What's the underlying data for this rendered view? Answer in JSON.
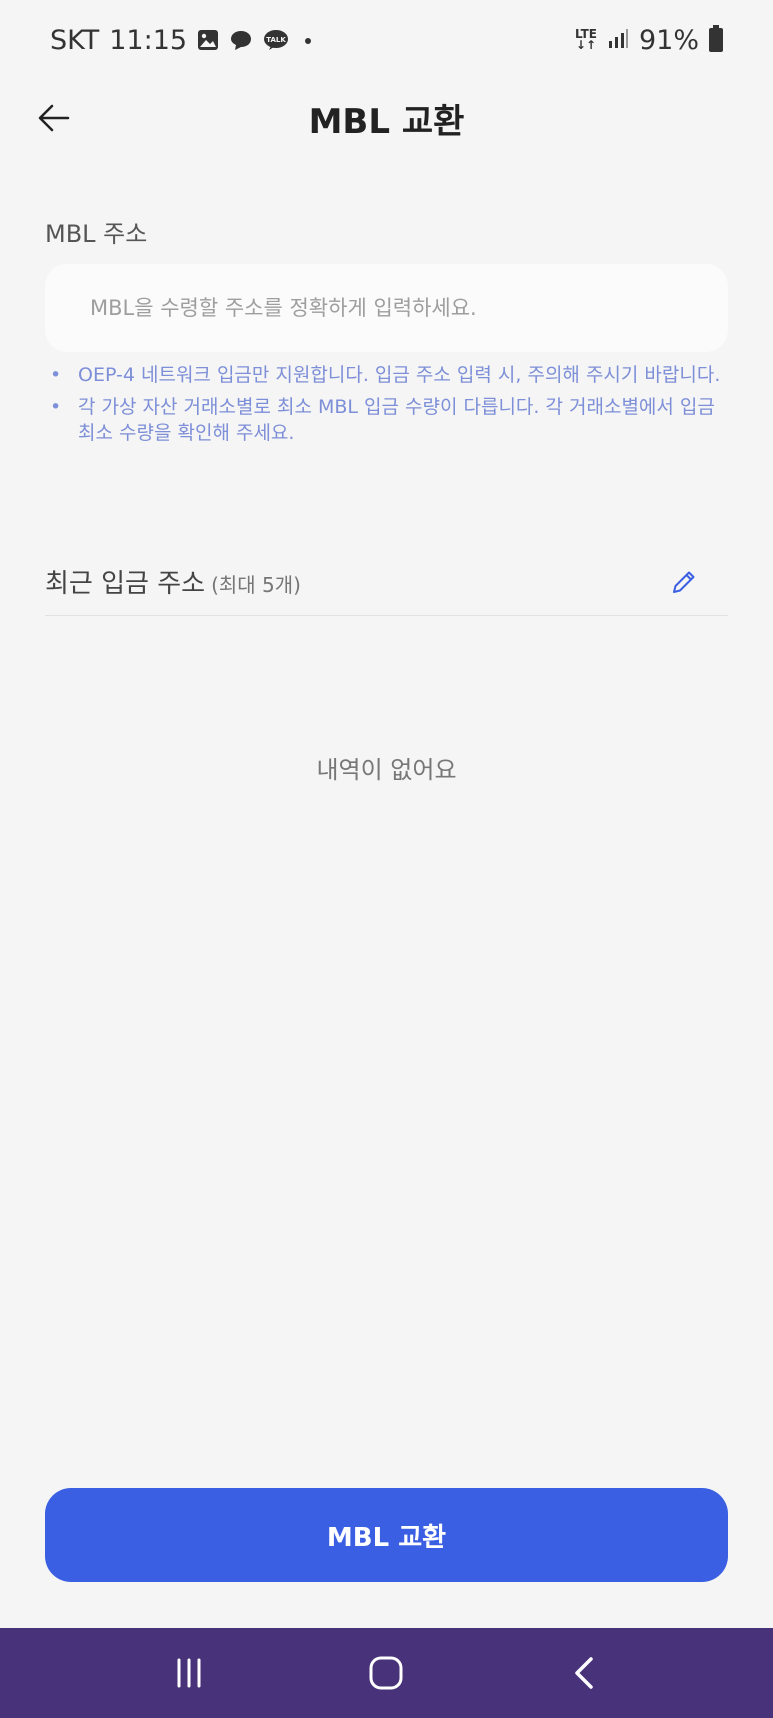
{
  "status_bar": {
    "carrier": "SKT",
    "time": "11:15",
    "network": "LTE",
    "battery": "91%",
    "icons": [
      "gallery-icon",
      "chat-bubble-icon",
      "kakaotalk-icon",
      "dot-icon"
    ]
  },
  "header": {
    "title": "MBL 교환",
    "back_icon": "arrow-left-icon"
  },
  "address": {
    "label": "MBL 주소",
    "placeholder": "MBL을 수령할 주소를 정확하게 입력하세요.",
    "value": ""
  },
  "notes": [
    "OEP-4 네트워크 입금만 지원합니다. 입금 주소 입력 시, 주의해 주시기 바랍니다.",
    "각 가상 자산 거래소별로 최소 MBL 입금 수량이 다릅니다. 각 거래소별에서 입금 최소 수량을 확인해 주세요."
  ],
  "recent": {
    "title": "최근 입금 주소",
    "subtitle": "(최대 5개)",
    "edit_icon": "pencil-icon",
    "empty_text": "내역이 없어요"
  },
  "submit": {
    "label": "MBL 교환"
  },
  "nav": {
    "icons": [
      "recent-apps-icon",
      "home-icon",
      "back-icon"
    ]
  },
  "colors": {
    "accent": "#3b5fe3",
    "note": "#7d8fd8",
    "nav_bg": "#48337a",
    "background": "#f5f5f5"
  }
}
